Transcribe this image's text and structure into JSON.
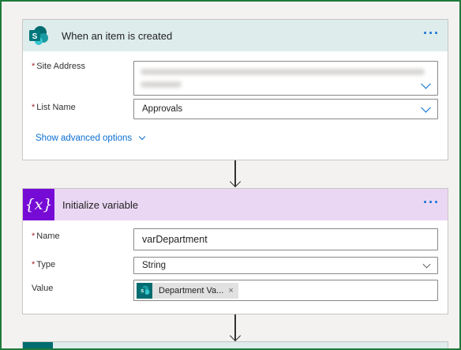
{
  "trigger": {
    "title": "When an item is created",
    "more_label": "···",
    "site_address": {
      "label": "Site Address",
      "required_mark": "*"
    },
    "list_name": {
      "label": "List Name",
      "required_mark": "*",
      "value": "Approvals"
    },
    "show_advanced": "Show advanced options"
  },
  "init_variable": {
    "title": "Initialize variable",
    "icon_glyph": "{x}",
    "more_label": "···",
    "name": {
      "label": "Name",
      "required_mark": "*",
      "value": "varDepartment"
    },
    "type": {
      "label": "Type",
      "required_mark": "*",
      "value": "String"
    },
    "value": {
      "label": "Value",
      "token_label": "Department Va...",
      "token_remove": "×"
    }
  },
  "colors": {
    "sharepoint_teal": "#036c70",
    "variable_purple": "#770bd6",
    "link_blue": "#0a6ed1",
    "required_red": "#a4262c"
  },
  "icons": {
    "trigger": "sharepoint-icon",
    "variable": "variable-icon",
    "token": "sharepoint-icon"
  }
}
